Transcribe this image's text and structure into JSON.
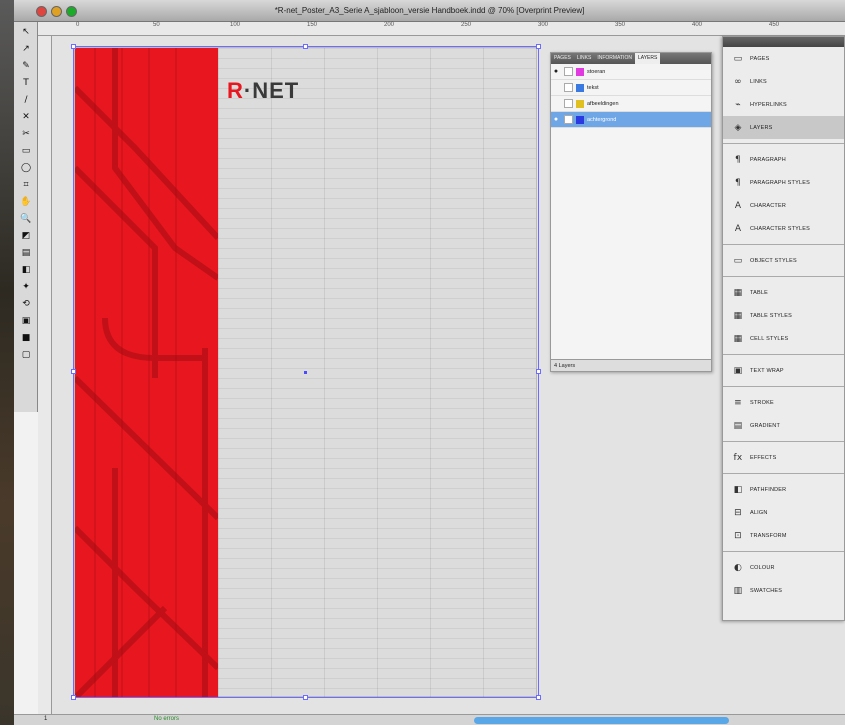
{
  "window": {
    "title": "*R-net_Poster_A3_Serie A_sjabloon_versie Handboek.indd @ 70% [Overprint Preview]"
  },
  "ruler": {
    "ticks": [
      "0",
      "50",
      "100",
      "150",
      "200",
      "250",
      "300",
      "350",
      "400",
      "450",
      "500"
    ]
  },
  "tools": [
    "↖",
    "↗",
    "✎",
    "T",
    "/",
    "✕",
    "✂",
    "▭",
    "◯",
    "⌗",
    "✋",
    "🔍",
    "◩",
    "▤",
    "◧",
    "✦",
    "⟲",
    "▣",
    "■",
    "▢"
  ],
  "logo": {
    "text_r": "R",
    "text_rest": "·NET"
  },
  "layers_panel": {
    "tabs": [
      "PAGES",
      "LINKS",
      "INFORMATION",
      "LAYERS"
    ],
    "active_tab": "LAYERS",
    "layers": [
      {
        "name": "stoeran",
        "color": "#e03ae0",
        "selected": false,
        "visible": true
      },
      {
        "name": "tekst",
        "color": "#3a7ae0",
        "selected": false,
        "visible": false
      },
      {
        "name": "afbeeldingen",
        "color": "#e0c020",
        "selected": false,
        "visible": false
      },
      {
        "name": "achtergrond",
        "color": "#2a3ae0",
        "selected": true,
        "visible": true
      }
    ],
    "footer": "4 Layers"
  },
  "right_panel": {
    "items": [
      {
        "icon": "▭",
        "label": "PAGES",
        "group": 1
      },
      {
        "icon": "∞",
        "label": "LINKS",
        "group": 1
      },
      {
        "icon": "⌁",
        "label": "HYPERLINKS",
        "group": 1
      },
      {
        "icon": "◈",
        "label": "LAYERS",
        "group": 1,
        "selected": true
      },
      {
        "icon": "¶",
        "label": "PARAGRAPH",
        "group": 2
      },
      {
        "icon": "¶",
        "label": "PARAGRAPH STYLES",
        "group": 2
      },
      {
        "icon": "A",
        "label": "CHARACTER",
        "group": 2
      },
      {
        "icon": "A",
        "label": "CHARACTER STYLES",
        "group": 2
      },
      {
        "icon": "▭",
        "label": "OBJECT STYLES",
        "group": 3
      },
      {
        "icon": "▦",
        "label": "TABLE",
        "group": 4
      },
      {
        "icon": "▦",
        "label": "TABLE STYLES",
        "group": 4
      },
      {
        "icon": "▦",
        "label": "CELL STYLES",
        "group": 4
      },
      {
        "icon": "▣",
        "label": "TEXT WRAP",
        "group": 5
      },
      {
        "icon": "≡",
        "label": "STROKE",
        "group": 6
      },
      {
        "icon": "▤",
        "label": "GRADIENT",
        "group": 6
      },
      {
        "icon": "fx",
        "label": "EFFECTS",
        "group": 7
      },
      {
        "icon": "◧",
        "label": "PATHFINDER",
        "group": 8
      },
      {
        "icon": "⊟",
        "label": "ALIGN",
        "group": 8
      },
      {
        "icon": "⊡",
        "label": "TRANSFORM",
        "group": 8
      },
      {
        "icon": "◐",
        "label": "COLOUR",
        "group": 9
      },
      {
        "icon": "▥",
        "label": "SWATCHES",
        "group": 9
      }
    ]
  },
  "statusbar": {
    "page": "1",
    "preflight": "No errors"
  }
}
